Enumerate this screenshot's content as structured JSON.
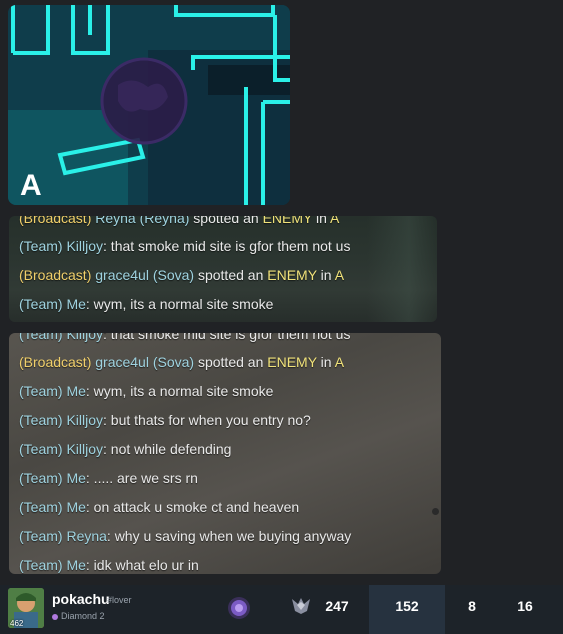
{
  "minimap": {
    "site_label": "A"
  },
  "chat_top": {
    "lines": [
      {
        "channel": "(Broadcast)",
        "channel_type": "broadcast",
        "name": "Reyna (Reyna)",
        "name_type": "broadcast",
        "pre": " spotted an ",
        "highlight": "ENEMY",
        "post": " in ",
        "highlight2": "A",
        "text": ""
      },
      {
        "channel": "(Team)",
        "channel_type": "team",
        "name": "Killjoy",
        "name_type": "team",
        "text": ": that smoke mid site is gfor them not us"
      },
      {
        "channel": "(Broadcast)",
        "channel_type": "broadcast",
        "name": "grace4ul (Sova)",
        "name_type": "team",
        "pre": " spotted an ",
        "highlight": "ENEMY",
        "post": " in ",
        "highlight2": "A",
        "text": ""
      },
      {
        "channel": "(Team)",
        "channel_type": "team",
        "name": "Me",
        "name_type": "team",
        "text": ": wym, its a normal site smoke"
      }
    ]
  },
  "chat_main": {
    "lines": [
      {
        "channel": "(Team)",
        "name": "Killjoy",
        "text": ": that smoke mid site is gfor them not us"
      },
      {
        "channel": "(Broadcast)",
        "name": "grace4ul (Sova)",
        "pre": " spotted an ",
        "highlight": "ENEMY",
        "post": " in ",
        "highlight2": "A"
      },
      {
        "channel": "(Team)",
        "name": "Me",
        "text": ": wym, its a normal site smoke"
      },
      {
        "channel": "(Team)",
        "name": "Killjoy",
        "text": ": but thats for when you entry no?"
      },
      {
        "channel": "(Team)",
        "name": "Killjoy",
        "text": ": not while defending"
      },
      {
        "channel": "(Team)",
        "name": "Me",
        "text": ": ..... are we srs rn"
      },
      {
        "channel": "(Team)",
        "name": "Me",
        "text": ": on attack u smoke ct and heaven"
      },
      {
        "channel": "(Team)",
        "name": "Reyna",
        "text": ": why u saving when we buying anyway"
      },
      {
        "channel": "(Team)",
        "name": "Me",
        "text": ": idk what elo ur in"
      }
    ]
  },
  "scoreboard": {
    "player_name": "pokachu",
    "player_tag": "#lover",
    "player_rank": "Diamond 2",
    "account_level": "462",
    "score": "247",
    "kills": "152",
    "deaths": "8",
    "assists": "16",
    "icons": {
      "agent": "agent-portrait-icon",
      "rank": "rank-badge-icon",
      "avatar": "player-card-avatar"
    }
  },
  "colors": {
    "team_channel": "#9fd3e0",
    "broadcast_channel": "#f0cf6a",
    "enemy_highlight": "#f0e27a",
    "minimap_wall": "#2af0e8"
  }
}
